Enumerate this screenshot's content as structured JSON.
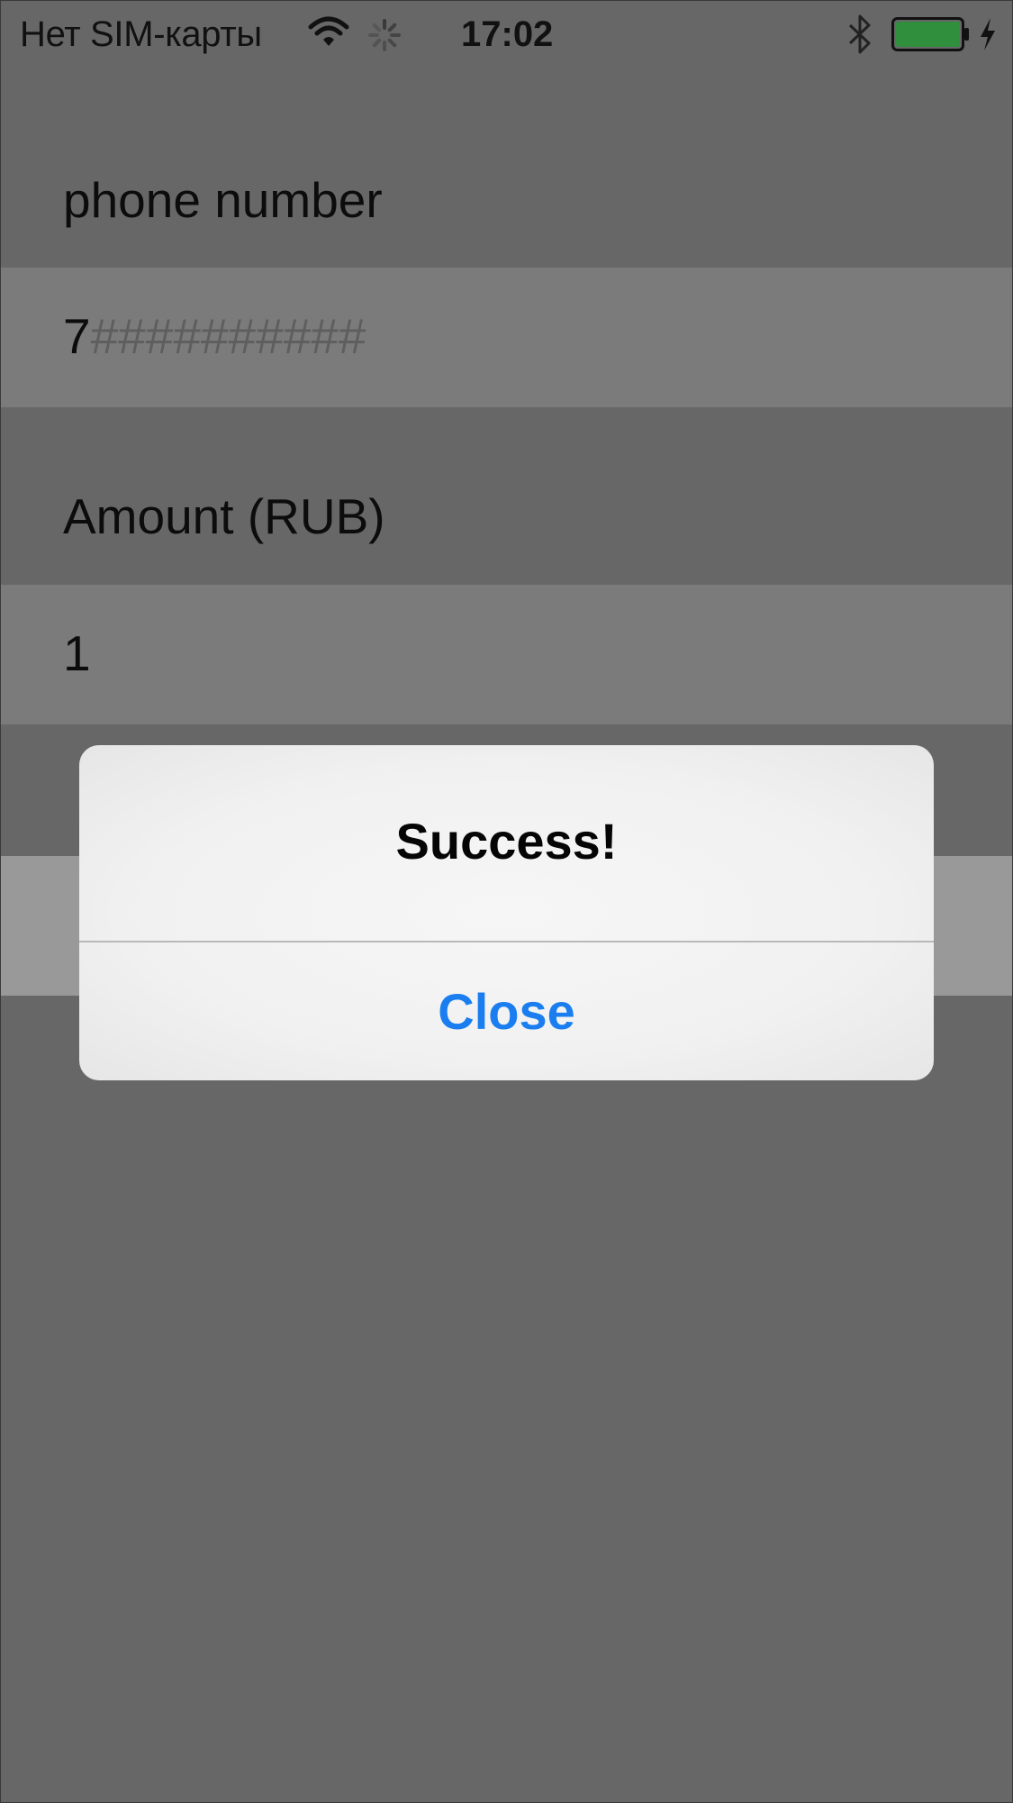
{
  "status_bar": {
    "carrier": "Нет SIM-карты",
    "time": "17:02",
    "icons": [
      "wifi-icon",
      "activity-spinner-icon",
      "bluetooth-icon",
      "battery-icon",
      "charging-bolt-icon"
    ],
    "battery_color": "#2f8f3c"
  },
  "form": {
    "phone_label": "phone number",
    "phone_value": "7",
    "phone_placeholder": "##########",
    "amount_label": "Amount (RUB)",
    "amount_value": "1"
  },
  "alert": {
    "title": "Success!",
    "close_label": "Close",
    "button_color": "#1a7ef0"
  }
}
